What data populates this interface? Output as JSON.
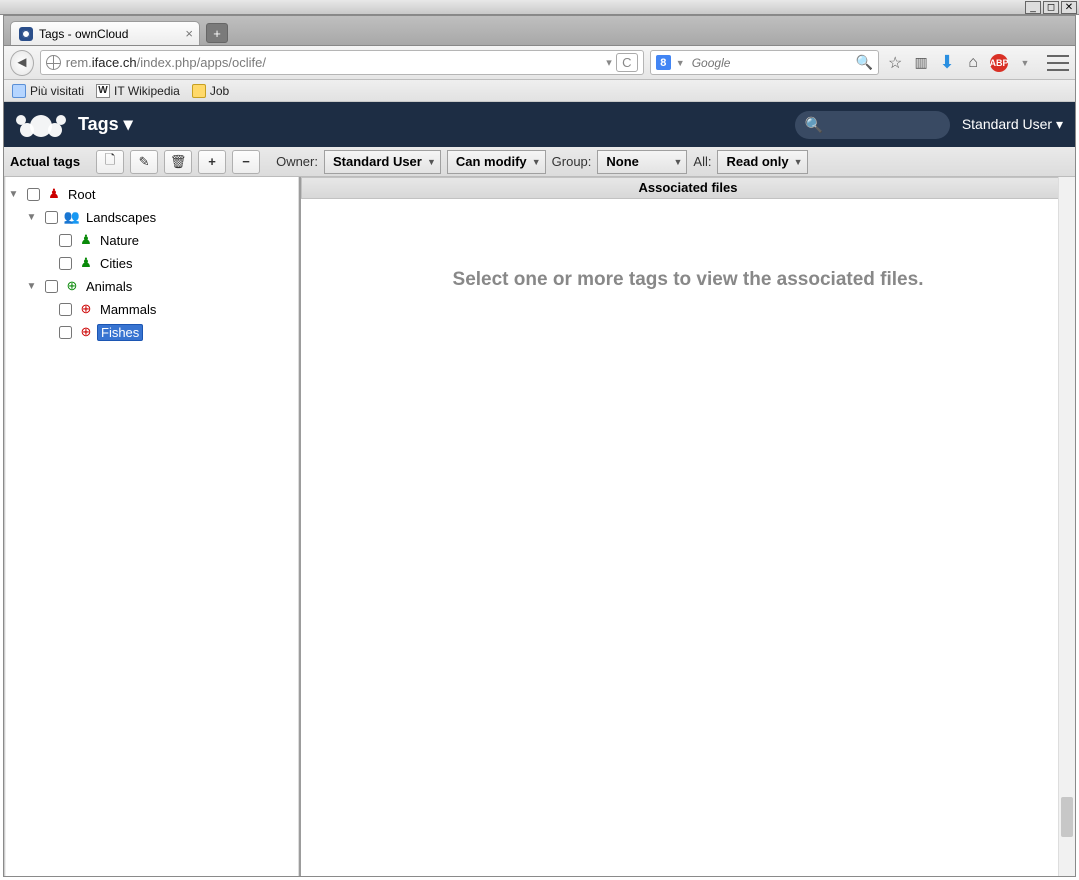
{
  "window": {
    "tab_title": "Tags - ownCloud",
    "url_prefix": "rem.",
    "url_host": "iface.ch",
    "url_path": "/index.php/apps/oclife/",
    "search_placeholder": "Google"
  },
  "bookmarks": [
    {
      "label": "Più visitati",
      "icon": "blue"
    },
    {
      "label": "IT Wikipedia",
      "icon": "wiki"
    },
    {
      "label": "Job",
      "icon": "folder"
    }
  ],
  "header": {
    "app_name": "Tags ▾",
    "username": "Standard User ▾"
  },
  "toolbar": {
    "title": "Actual tags",
    "owner_label": "Owner:",
    "owner_value": "Standard User",
    "owner_perm": "Can modify",
    "group_label": "Group:",
    "group_value": "None",
    "all_label": "All:",
    "all_value": "Read only"
  },
  "tree": {
    "root": {
      "label": "Root"
    },
    "landscapes": {
      "label": "Landscapes"
    },
    "nature": {
      "label": "Nature"
    },
    "cities": {
      "label": "Cities"
    },
    "animals": {
      "label": "Animals"
    },
    "mammals": {
      "label": "Mammals"
    },
    "fishes": {
      "label": "Fishes"
    }
  },
  "main": {
    "header": "Associated files",
    "placeholder": "Select one or more tags to view the associated files."
  }
}
